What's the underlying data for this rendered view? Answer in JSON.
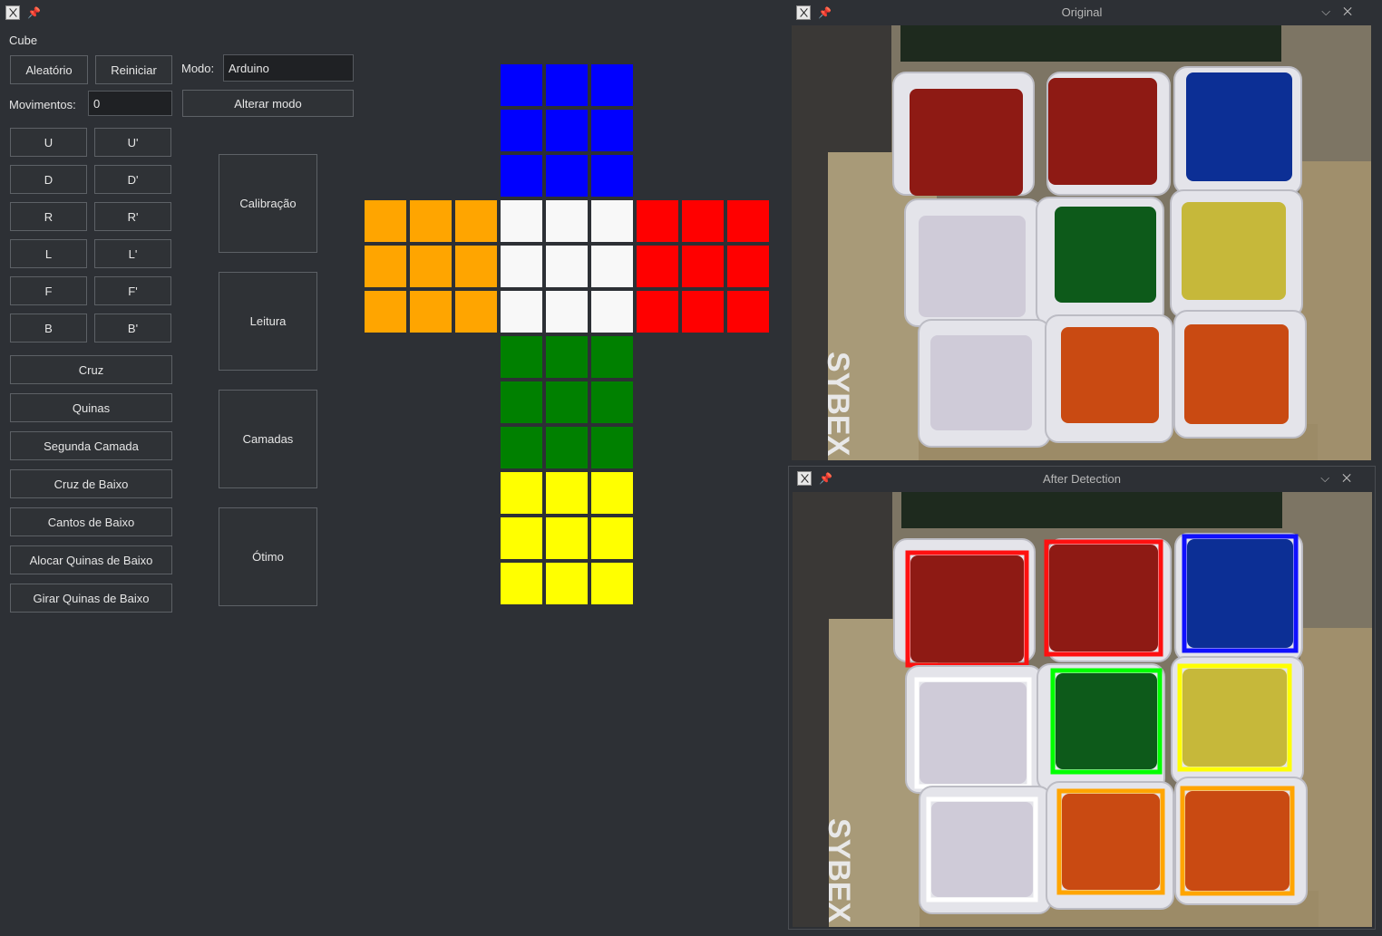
{
  "window": {
    "title": "Cube"
  },
  "top_row": {
    "random_label": "Aleatório",
    "restart_label": "Reiniciar",
    "mode_label": "Modo:",
    "mode_value": "Arduino"
  },
  "moves": {
    "label": "Movimentos:",
    "value": "0",
    "change_mode_label": "Alterar modo"
  },
  "move_buttons": [
    "U",
    "U'",
    "D",
    "D'",
    "R",
    "R'",
    "L",
    "L'",
    "F",
    "F'",
    "B",
    "B'"
  ],
  "algorithm_buttons": [
    "Cruz",
    "Quinas",
    "Segunda Camada",
    "Cruz de Baixo",
    "Cantos de Baixo",
    "Alocar Quinas de Baixo",
    "Girar Quinas de Baixo"
  ],
  "side_buttons": [
    "Calibração",
    "Leitura",
    "Camadas",
    "Ótimo"
  ],
  "colors": {
    "blue": "#0000ff",
    "orange": "#ffa500",
    "white": "#f8f8f8",
    "red": "#ff0000",
    "green": "#008000",
    "yellow": "#ffff00"
  },
  "cube_net": {
    "up": [
      "blue",
      "blue",
      "blue",
      "blue",
      "blue",
      "blue",
      "blue",
      "blue",
      "blue"
    ],
    "left": [
      "orange",
      "orange",
      "orange",
      "orange",
      "orange",
      "orange",
      "orange",
      "orange",
      "orange"
    ],
    "front": [
      "white",
      "white",
      "white",
      "white",
      "white",
      "white",
      "white",
      "white",
      "white"
    ],
    "right": [
      "red",
      "red",
      "red",
      "red",
      "red",
      "red",
      "red",
      "red",
      "red"
    ],
    "down": [
      "green",
      "green",
      "green",
      "green",
      "green",
      "green",
      "green",
      "green",
      "green"
    ],
    "back": [
      "yellow",
      "yellow",
      "yellow",
      "yellow",
      "yellow",
      "yellow",
      "yellow",
      "yellow",
      "yellow"
    ]
  },
  "original_window": {
    "title": "Original"
  },
  "detection_window": {
    "title": "After Detection"
  },
  "camera_faces": [
    "red",
    "red",
    "blue",
    "white",
    "green",
    "yellow",
    "white",
    "orange",
    "orange"
  ],
  "camera_face_colors": {
    "red": "#8e1a14",
    "blue": "#0c2f95",
    "white": "#cfcbd8",
    "green": "#0d5a1a",
    "yellow": "#c6b83a",
    "orange": "#c94a12"
  },
  "outline_colors": {
    "red": "#ff1010",
    "blue": "#1010ff",
    "white": "#ffffff",
    "green": "#00ff00",
    "yellow": "#ffff00",
    "orange": "#ffa500"
  },
  "book_text": "SYBEX"
}
